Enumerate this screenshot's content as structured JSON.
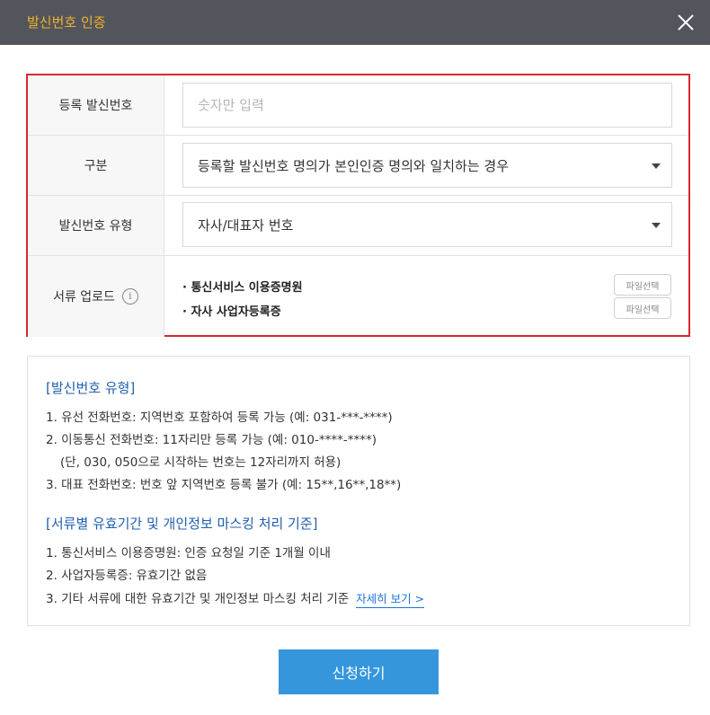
{
  "header": {
    "title": "발신번호 인증",
    "close_icon": "close-icon"
  },
  "form": {
    "phone": {
      "label": "등록 발신번호",
      "placeholder": "숫자만 입력",
      "value": ""
    },
    "category": {
      "label": "구분",
      "selected": "등록할 발신번호 명의가 본인인증 명의와 일치하는 경우"
    },
    "type": {
      "label": "발신번호 유형",
      "selected": "자사/대표자 번호"
    },
    "upload": {
      "label": "서류 업로드",
      "info_icon": "info-icon",
      "items": [
        {
          "name": "· 통신서비스 이용증명원",
          "button": "파일선택"
        },
        {
          "name": "· 자사 사업자등록증",
          "button": "파일선택"
        }
      ]
    }
  },
  "notice": {
    "section1": {
      "heading": "[발신번호 유형]",
      "lines": [
        "1. 유선 전화번호: 지역번호 포함하여 등록 가능 (예: 031-***-****)",
        "2. 이동통신 전화번호: 11자리만 등록 가능 (예: 010-****-****)",
        "(단, 030, 050으로 시작하는 번호는 12자리까지 허용)",
        "3. 대표 전화번호: 번호 앞 지역번호 등록 불가 (예: 15**,16**,18**)"
      ]
    },
    "section2": {
      "heading": "[서류별 유효기간 및 개인정보 마스킹 처리 기준]",
      "lines": [
        "1. 통신서비스 이용증명원: 인증 요청일 기준 1개월 이내",
        "2. 사업자등록증: 유효기간 없음",
        "3. 기타 서류에 대한 유효기간 및 개인정보 마스킹 처리 기준"
      ],
      "link": "자세히 보기 >"
    }
  },
  "submit_label": "신청하기",
  "colors": {
    "header_bg": "#52565c",
    "header_title": "#f3b02d",
    "highlight_border": "#d7282f",
    "notice_heading": "#1f5fb0",
    "link": "#1a73d9",
    "submit_bg": "#3596dc"
  }
}
